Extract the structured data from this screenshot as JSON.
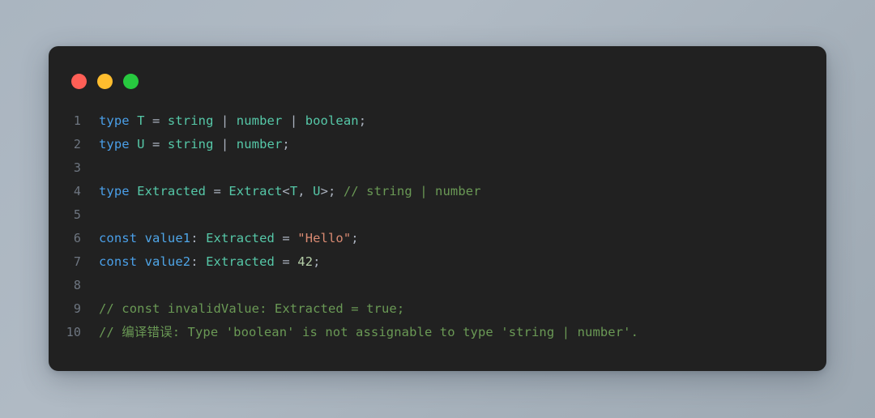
{
  "window": {
    "controls": [
      {
        "name": "close",
        "label": "Close",
        "color": "#ff5f56"
      },
      {
        "name": "minimize",
        "label": "Minimize",
        "color": "#ffbd2e"
      },
      {
        "name": "maximize",
        "label": "Maximize",
        "color": "#27c93f"
      }
    ]
  },
  "theme": {
    "page_background": "#aab5c0",
    "card_background": "#212121",
    "gutter_color": "#6e7681",
    "keyword": "#4a9fe8",
    "type": "#56c8a8",
    "variable": "#4fa6e8",
    "string": "#d98a72",
    "number": "#b5cea8",
    "comment": "#6a9955",
    "punctuation": "#abb2bf"
  },
  "editor": {
    "language": "typescript",
    "line_numbers": [
      "1",
      "2",
      "3",
      "4",
      "5",
      "6",
      "7",
      "8",
      "9",
      "10"
    ],
    "lines": [
      {
        "number": "1",
        "text": "type T = string | number | boolean;",
        "tokens": [
          {
            "t": "type",
            "c": "keyword"
          },
          {
            "t": " ",
            "c": "plain"
          },
          {
            "t": "T",
            "c": "type"
          },
          {
            "t": " = ",
            "c": "punct"
          },
          {
            "t": "string",
            "c": "type"
          },
          {
            "t": " | ",
            "c": "punct"
          },
          {
            "t": "number",
            "c": "type"
          },
          {
            "t": " | ",
            "c": "punct"
          },
          {
            "t": "boolean",
            "c": "type"
          },
          {
            "t": ";",
            "c": "punct"
          }
        ]
      },
      {
        "number": "2",
        "text": "type U = string | number;",
        "tokens": [
          {
            "t": "type",
            "c": "keyword"
          },
          {
            "t": " ",
            "c": "plain"
          },
          {
            "t": "U",
            "c": "type"
          },
          {
            "t": " = ",
            "c": "punct"
          },
          {
            "t": "string",
            "c": "type"
          },
          {
            "t": " | ",
            "c": "punct"
          },
          {
            "t": "number",
            "c": "type"
          },
          {
            "t": ";",
            "c": "punct"
          }
        ]
      },
      {
        "number": "3",
        "text": "",
        "tokens": []
      },
      {
        "number": "4",
        "text": "type Extracted = Extract<T, U>; // string | number",
        "tokens": [
          {
            "t": "type",
            "c": "keyword"
          },
          {
            "t": " ",
            "c": "plain"
          },
          {
            "t": "Extracted",
            "c": "type"
          },
          {
            "t": " = ",
            "c": "punct"
          },
          {
            "t": "Extract",
            "c": "type"
          },
          {
            "t": "<",
            "c": "punct"
          },
          {
            "t": "T",
            "c": "type"
          },
          {
            "t": ", ",
            "c": "punct"
          },
          {
            "t": "U",
            "c": "type"
          },
          {
            "t": ">; ",
            "c": "punct"
          },
          {
            "t": "// string | number",
            "c": "comment"
          }
        ]
      },
      {
        "number": "5",
        "text": "",
        "tokens": []
      },
      {
        "number": "6",
        "text": "const value1: Extracted = \"Hello\";",
        "tokens": [
          {
            "t": "const",
            "c": "keyword"
          },
          {
            "t": " ",
            "c": "plain"
          },
          {
            "t": "value1",
            "c": "var"
          },
          {
            "t": ": ",
            "c": "punct"
          },
          {
            "t": "Extracted",
            "c": "type"
          },
          {
            "t": " = ",
            "c": "punct"
          },
          {
            "t": "\"Hello\"",
            "c": "string"
          },
          {
            "t": ";",
            "c": "punct"
          }
        ]
      },
      {
        "number": "7",
        "text": "const value2: Extracted = 42;",
        "tokens": [
          {
            "t": "const",
            "c": "keyword"
          },
          {
            "t": " ",
            "c": "plain"
          },
          {
            "t": "value2",
            "c": "var"
          },
          {
            "t": ": ",
            "c": "punct"
          },
          {
            "t": "Extracted",
            "c": "type"
          },
          {
            "t": " = ",
            "c": "punct"
          },
          {
            "t": "42",
            "c": "number"
          },
          {
            "t": ";",
            "c": "punct"
          }
        ]
      },
      {
        "number": "8",
        "text": "",
        "tokens": []
      },
      {
        "number": "9",
        "text": "// const invalidValue: Extracted = true;",
        "tokens": [
          {
            "t": "// const invalidValue: Extracted = true;",
            "c": "comment"
          }
        ]
      },
      {
        "number": "10",
        "text": "// 编译错误: Type 'boolean' is not assignable to type 'string | number'.",
        "tokens": [
          {
            "t": "// 编译错误: Type 'boolean' is not assignable to type 'string | number'.",
            "c": "comment"
          }
        ]
      }
    ]
  }
}
